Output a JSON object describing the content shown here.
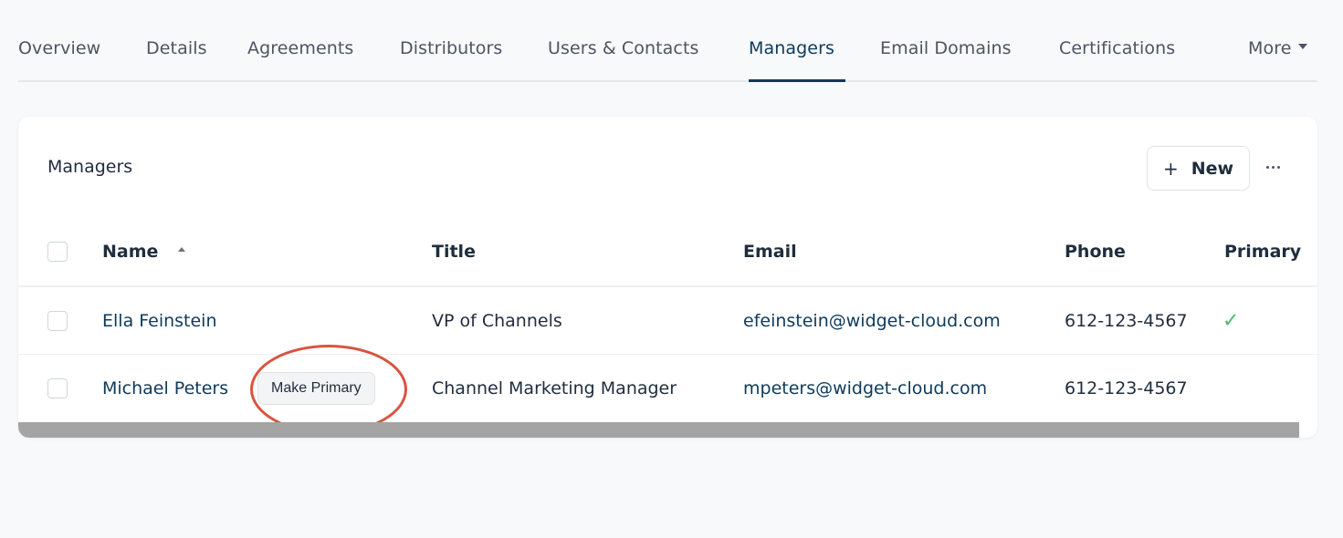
{
  "tabs": [
    {
      "label": "Overview",
      "active": false
    },
    {
      "label": "Details",
      "active": false
    },
    {
      "label": "Agreements",
      "active": false
    },
    {
      "label": "Distributors",
      "active": false
    },
    {
      "label": "Users & Contacts",
      "active": false
    },
    {
      "label": "Managers",
      "active": true
    },
    {
      "label": "Email Domains",
      "active": false
    },
    {
      "label": "Certifications",
      "active": false
    },
    {
      "label": "More",
      "active": false
    }
  ],
  "card": {
    "title": "Managers",
    "new_button": {
      "icon": "plus-icon",
      "label": "New"
    },
    "more_icon": "ellipsis-icon"
  },
  "table": {
    "columns": [
      "Name",
      "Title",
      "Email",
      "Phone",
      "Primary"
    ],
    "sort_column": "Name",
    "sort_direction": "ascending",
    "rows": [
      {
        "name": "Ella Feinstein",
        "title": "VP of Channels",
        "email": "efeinstein@widget-cloud.com",
        "phone": "612-123-4567",
        "primary": true,
        "primary_icon": "checkmark-icon"
      },
      {
        "name": "Michael Peters",
        "title": "Channel Marketing Manager",
        "email": "mpeters@widget-cloud.com",
        "phone": "612-123-4567",
        "primary": false,
        "action_label": "Make Primary"
      }
    ]
  },
  "colors": {
    "accent": "#0e3a5b",
    "check": "#4cbb6a",
    "highlight": "#d9533f",
    "background": "#f8f9fa"
  }
}
